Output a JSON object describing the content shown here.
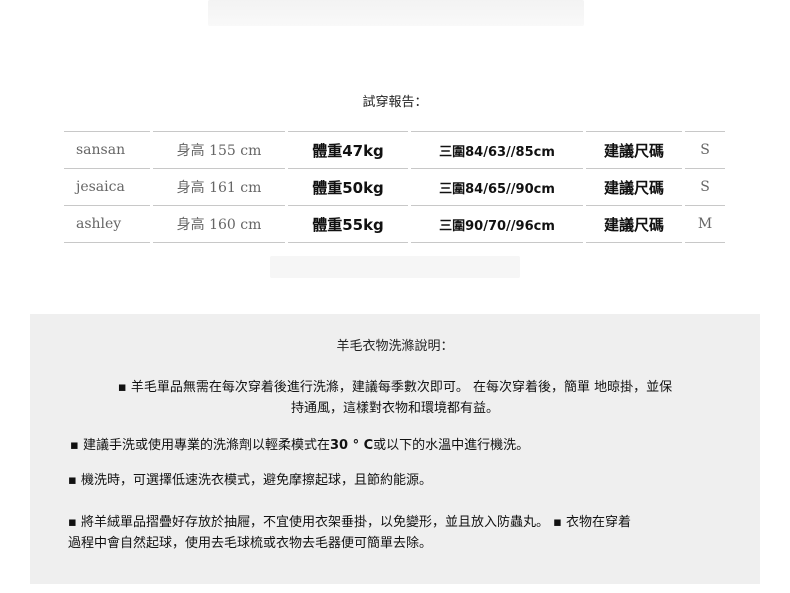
{
  "report_title": "試穿報告：",
  "rows": [
    {
      "name": "sansan",
      "height": "身高 155 cm",
      "weight": "體重47kg",
      "measure": "三圍84/63//85cm",
      "suggest_label": "建議尺碼",
      "size": "S"
    },
    {
      "name": "jesaica",
      "height": "身高 161 cm",
      "weight": "體重50kg",
      "measure": "三圍84/65//90cm",
      "suggest_label": "建議尺碼",
      "size": "S"
    },
    {
      "name": "ashley",
      "height": "身高 160 cm",
      "weight": "體重55kg",
      "measure": "三圍90/70//96cm",
      "suggest_label": "建議尺碼",
      "size": "M"
    }
  ],
  "care": {
    "title": "羊毛衣物洗滌說明：",
    "p1_line1": "▪ 羊毛單品無需在每次穿着後進行洗滌，建議每季數次即可。 在每次穿着後，簡單 地晾掛，並保",
    "p1_line2": "持通風，這樣對衣物和環境都有益。",
    "p2_before": "▪ 建議手洗或使用專業的洗滌劑以輕柔模式在",
    "p2_temp": "30 ° C",
    "p2_after": "或以下的水溫中進行機洗。",
    "p3": "▪ 機洗時，可選擇低速洗衣模式，避免摩擦起球，且節約能源。",
    "p4_line1": "▪ 將羊絨單品摺疊好存放於抽屜，不宜使用衣架垂掛，以免變形，並且放入防蟲丸。 ▪ 衣物在穿着",
    "p4_line2": "過程中會自然起球，使用去毛球梳或衣物去毛器便可簡單去除。"
  }
}
